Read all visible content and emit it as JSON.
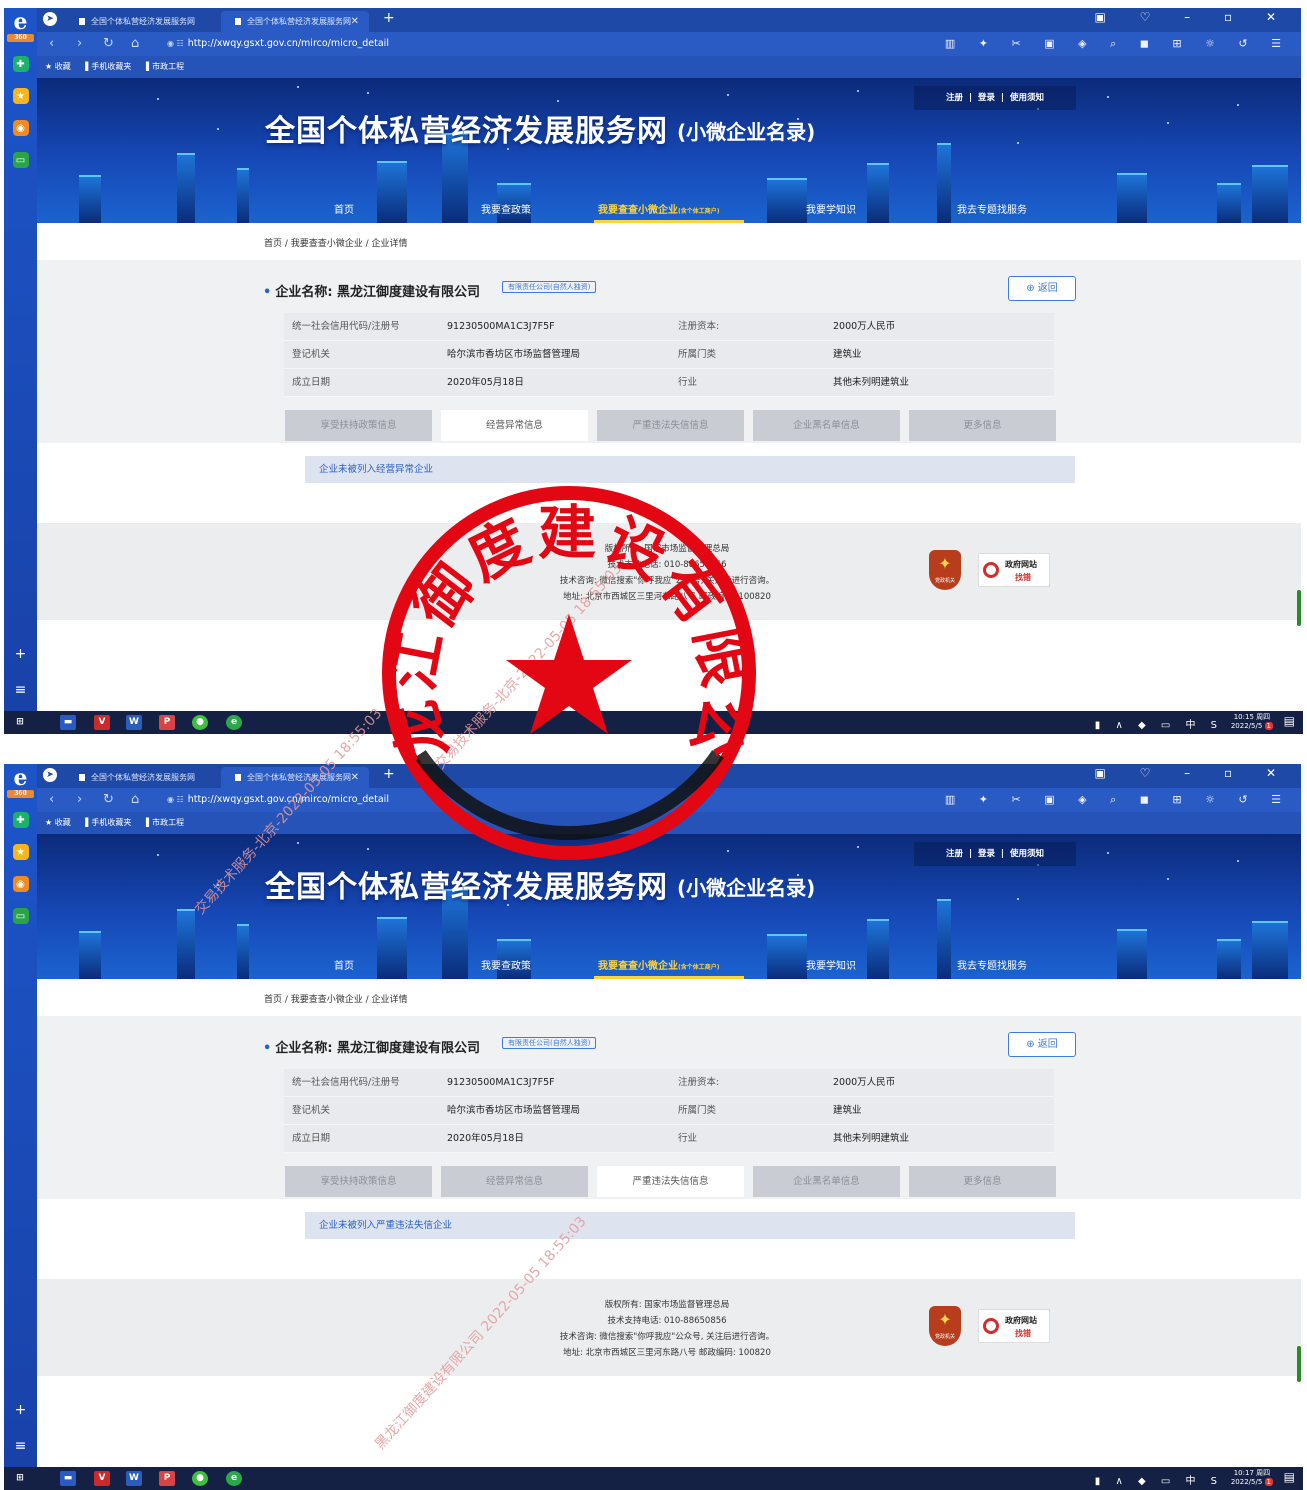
{
  "browser": {
    "sidebar_label": "360",
    "tabs": [
      {
        "label": "全国个体私营经济发展服务网"
      },
      {
        "label": "全国个体私营经济发展服务网"
      }
    ],
    "url": "http://xwqy.gsxt.gov.cn/mirco/micro_detail",
    "url_secure_label": "◉ ☷",
    "favorites": [
      "★ 收藏",
      "▌手机收藏夹",
      "▌市政工程"
    ]
  },
  "site": {
    "title": "全国个体私营经济发展服务网",
    "subtitle": "(小微企业名录)",
    "top_links": [
      "注册",
      "登录",
      "使用须知"
    ],
    "nav": [
      {
        "label": "首页"
      },
      {
        "label": "我要查政策"
      },
      {
        "label": "我要查查小微企业",
        "suffix": "(含个体工商户)"
      },
      {
        "label": "我要学知识"
      },
      {
        "label": "我去专题找服务"
      }
    ],
    "breadcrumb": "首页 / 我要查查小微企业 / 企业详情"
  },
  "enterprise": {
    "name_label": "企业名称:",
    "name": "黑龙江御度建设有限公司",
    "type": "有限责任公司(自然人独资)",
    "back_label": "返回",
    "rows": [
      [
        "统一社会信用代码/注册号",
        "91230500MA1C3J7F5F",
        "注册资本:",
        "2000万人民币"
      ],
      [
        "登记机关",
        "哈尔滨市香坊区市场监督管理局",
        "所属门类",
        "建筑业"
      ],
      [
        "成立日期",
        "2020年05月18日",
        "行业",
        "其他未列明建筑业"
      ]
    ],
    "detail_tabs": [
      "享受扶持政策信息",
      "经营异常信息",
      "严重违法失信信息",
      "企业黑名单信息",
      "更多信息"
    ]
  },
  "screens": [
    {
      "active_tab": 1,
      "notice": "企业未被列入经营异常企业",
      "clock_time": "10:15 周四",
      "clock_date": "2022/5/5"
    },
    {
      "active_tab": 2,
      "notice": "企业未被列入严重违法失信企业",
      "clock_time": "10:17 周四",
      "clock_date": "2022/5/5"
    }
  ],
  "footer": {
    "lines": [
      "版权所有: 国家市场监督管理总局",
      "技术支持电话: 010-88650856",
      "技术咨询: 微信搜索\"你呼我应\"公众号, 关注后进行咨询。",
      "地址: 北京市西城区三里河东路八号 邮政编码: 100820"
    ],
    "gov_badge": [
      "政府网站",
      "找错"
    ],
    "emblem_text": "党政机关"
  },
  "watermarks": [
    "交易技术服务-北京-2022-05-05 18:55:03",
    "黑龙江御度建设有限公司 2022-05-05 18:55:03"
  ],
  "seal": {
    "text": "黑龙江御度建设有限公司",
    "color": "#e30613"
  }
}
